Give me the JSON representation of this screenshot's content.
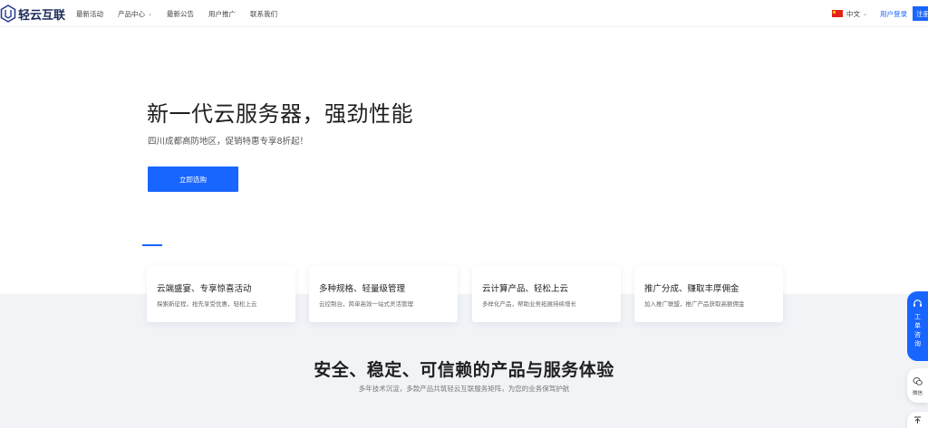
{
  "header": {
    "logo_text": "轻云互联",
    "nav": [
      {
        "label": "最新活动",
        "has_dropdown": false
      },
      {
        "label": "产品中心",
        "has_dropdown": true
      },
      {
        "label": "最新公告",
        "has_dropdown": false
      },
      {
        "label": "用户推广",
        "has_dropdown": false
      },
      {
        "label": "联系我们",
        "has_dropdown": false
      }
    ],
    "language": "中文",
    "login_label": "用户登录",
    "register_label": "注册"
  },
  "hero": {
    "title": "新一代云服务器，强劲性能",
    "subtitle": "四川成都高防地区，促销特惠专享8折起！",
    "button_label": "立即选购"
  },
  "features": [
    {
      "title": "云端盛宴、专享惊喜活动",
      "desc": "探索新征程，抢先享受优惠，轻松上云"
    },
    {
      "title": "多种规格、轻量级管理",
      "desc": "云控制台，简单高效一站式灵活管理"
    },
    {
      "title": "云计算产品、轻松上云",
      "desc": "多样化产品，帮助业务拓展持续增长"
    },
    {
      "title": "推广分成、赚取丰厚佣金",
      "desc": "加入推广联盟，推广产品获取高额佣金"
    }
  ],
  "section": {
    "title": "安全、稳定、可信赖的产品与服务体验",
    "subtitle": "多年技术沉淀，多款产品共筑轻云互联服务矩阵，为您的业务保驾护航"
  },
  "floating": {
    "ticket_label": "工单咨询",
    "wechat_label": "微信"
  },
  "colors": {
    "accent": "#1865ff",
    "band": "#f1f3f7"
  }
}
